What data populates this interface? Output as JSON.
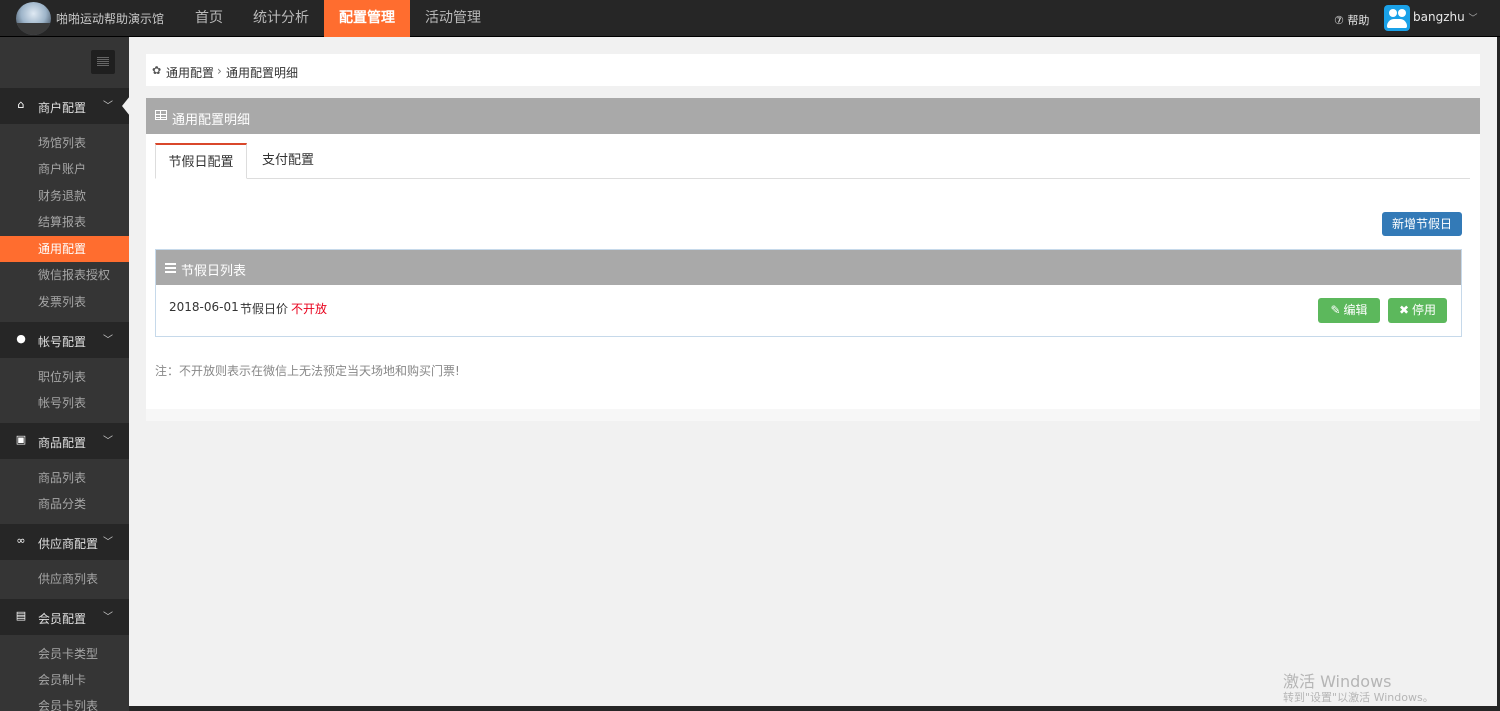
{
  "header": {
    "site_name": "啪啪运动帮助演示馆",
    "nav": [
      {
        "label": "首页",
        "active": false
      },
      {
        "label": "统计分析",
        "active": false
      },
      {
        "label": "配置管理",
        "active": true
      },
      {
        "label": "活动管理",
        "active": false
      }
    ],
    "help_label": "⑦ 帮助",
    "username": "bangzhu",
    "user_chevron": "﹀"
  },
  "sidebar": {
    "sections": [
      {
        "label": "商户配置",
        "icon": "home-icon",
        "items": [
          "场馆列表",
          "商户账户",
          "财务退款",
          "结算报表",
          "通用配置",
          "微信报表授权",
          "发票列表"
        ],
        "active_item": "通用配置"
      },
      {
        "label": "帐号配置",
        "icon": "user-icon",
        "items": [
          "职位列表",
          "帐号列表"
        ]
      },
      {
        "label": "商品配置",
        "icon": "gift-icon",
        "items": [
          "商品列表",
          "商品分类"
        ]
      },
      {
        "label": "供应商配置",
        "icon": "link-icon",
        "items": [
          "供应商列表"
        ]
      },
      {
        "label": "会员配置",
        "icon": "id-card-icon",
        "items": [
          "会员卡类型",
          "会员制卡",
          "会员卡列表"
        ]
      }
    ],
    "chevron": "﹀"
  },
  "breadcrumb": {
    "items": [
      "通用配置",
      "通用配置明细"
    ],
    "separator": "›"
  },
  "panel": {
    "title": "通用配置明细",
    "tabs": [
      {
        "label": "节假日配置",
        "active": true
      },
      {
        "label": "支付配置",
        "active": false
      }
    ],
    "add_button": "新增节假日",
    "list": {
      "title": "节假日列表",
      "rows": [
        {
          "date": "2018-06-01",
          "label": "节假日价",
          "status": "不开放",
          "edit_label": "编辑",
          "disable_label": "停用"
        }
      ]
    },
    "note": "注：不开放则表示在微信上无法预定当天场地和购买门票!"
  },
  "watermark": {
    "line1": "激活 Windows",
    "line2": "转到\"设置\"以激活 Windows。"
  },
  "colors": {
    "accent": "#ff6d2f",
    "topbar": "#262626",
    "sidebar": "#353535",
    "panel_header": "#a9a9a9",
    "primary_button": "#337ab7",
    "success_button": "#5cb85c",
    "danger_text": "#e8001c"
  }
}
